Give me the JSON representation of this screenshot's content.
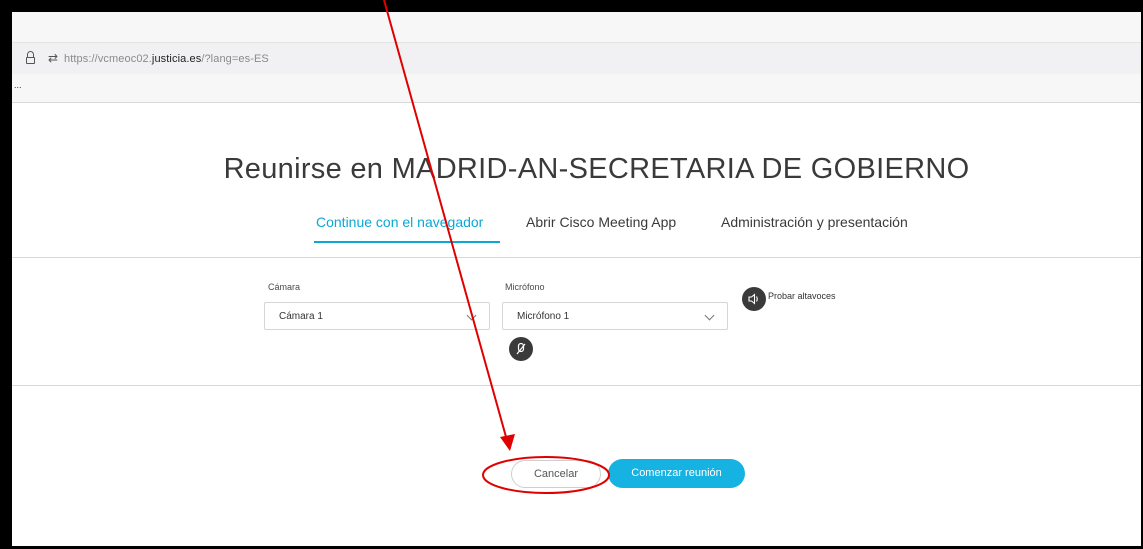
{
  "browser": {
    "url_prefix": "https://vcmeoc02.",
    "url_domain": "justicia.es",
    "url_suffix": "/?lang=es-ES",
    "bookmark_overflow": "..."
  },
  "page": {
    "title": "Reunirse en MADRID-AN-SECRETARIA DE GOBIERNO",
    "tabs": [
      {
        "label": "Continue con el navegador",
        "active": true
      },
      {
        "label": "Abrir Cisco Meeting App",
        "active": false
      },
      {
        "label": "Administración y presentación",
        "active": false
      }
    ]
  },
  "devices": {
    "camera_label": "Cámara",
    "camera_value": "Cámara 1",
    "microphone_label": "Micrófono",
    "microphone_value": "Micrófono 1",
    "test_speakers_label": "Probar altavoces"
  },
  "actions": {
    "cancel_label": "Cancelar",
    "start_label": "Comenzar reunión"
  },
  "colors": {
    "accent": "#0aa8d6",
    "annotation": "#e00000"
  },
  "icons": [
    "lock-icon",
    "site-permissions-icon",
    "speaker-icon",
    "mic-muted-icon",
    "chevron-down-icon"
  ]
}
